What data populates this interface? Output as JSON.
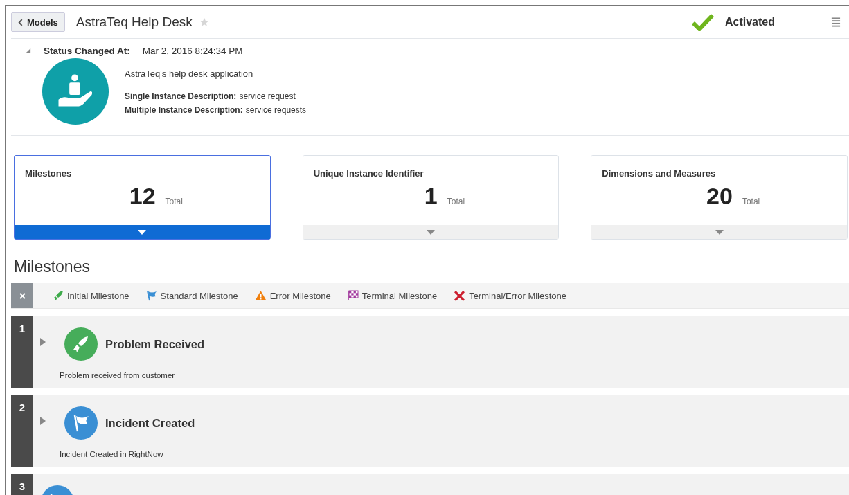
{
  "header": {
    "back_button": "Models",
    "title": "AstraTeq Help Desk",
    "favorite": false,
    "status": "Activated"
  },
  "details": {
    "expanded": true,
    "status_label": "Status Changed At:",
    "status_value": "Mar 2, 2016 8:24:34 PM",
    "description": "AstraTeq's help desk application",
    "fields": [
      {
        "label": "Single Instance Description:",
        "value": "service request"
      },
      {
        "label": "Multiple Instance Description:",
        "value": "service requests"
      }
    ]
  },
  "cards": [
    {
      "title": "Milestones",
      "value": "12",
      "unit": "Total",
      "selected": true
    },
    {
      "title": "Unique Instance Identifier",
      "value": "1",
      "unit": "Total",
      "selected": false
    },
    {
      "title": "Dimensions and Measures",
      "value": "20",
      "unit": "Total",
      "selected": false
    }
  ],
  "section_title": "Milestones",
  "legend": [
    {
      "kind": "initial",
      "label": "Initial Milestone"
    },
    {
      "kind": "standard",
      "label": "Standard Milestone"
    },
    {
      "kind": "error",
      "label": "Error Milestone"
    },
    {
      "kind": "terminal",
      "label": "Terminal Milestone"
    },
    {
      "kind": "terminal_error",
      "label": "Terminal/Error Milestone"
    }
  ],
  "milestones": [
    {
      "number": "1",
      "kind": "initial",
      "title": "Problem Received",
      "description": "Problem received from customer",
      "expanded": false
    },
    {
      "number": "2",
      "kind": "standard",
      "title": "Incident Created",
      "description": "Incident Created in RightNow",
      "expanded": false
    },
    {
      "number": "3",
      "kind": "standard"
    }
  ]
}
